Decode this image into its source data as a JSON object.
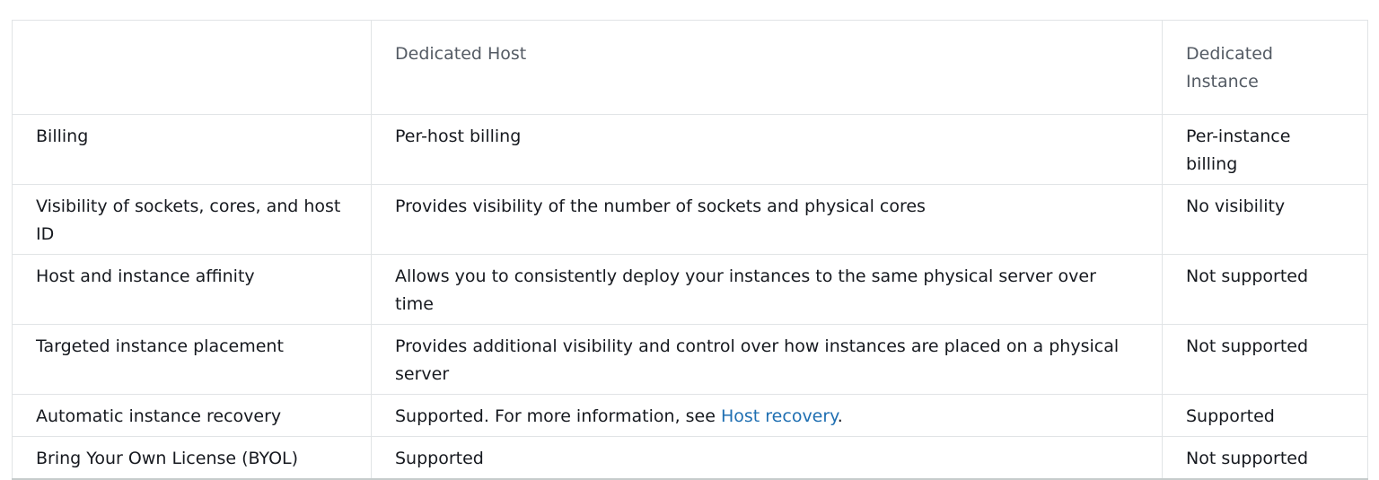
{
  "table": {
    "headers": [
      "",
      "Dedicated Host",
      "Dedicated Instance"
    ],
    "rows": [
      {
        "feature": "Billing",
        "host": "Per-host billing",
        "instance": "Per-instance billing"
      },
      {
        "feature": "Visibility of sockets, cores, and host ID",
        "host": "Provides visibility of the number of sockets and physical cores",
        "instance": "No visibility"
      },
      {
        "feature": "Host and instance affinity",
        "host": "Allows you to consistently deploy your instances to the same physical server over time",
        "instance": "Not supported"
      },
      {
        "feature": "Targeted instance placement",
        "host": "Provides additional visibility and control over how instances are placed on a physical server",
        "instance": "Not supported"
      },
      {
        "feature": "Automatic instance recovery",
        "host_prefix": "Supported. For more information, see ",
        "host_link": "Host recovery",
        "host_suffix": ".",
        "instance": "Supported"
      },
      {
        "feature": "Bring Your Own License (BYOL)",
        "host": "Supported",
        "instance": "Not supported"
      }
    ]
  },
  "colors": {
    "link": "#1f6fb2",
    "header_text": "#545b64",
    "body_text": "#16191f",
    "border": "#e1e4e6"
  }
}
